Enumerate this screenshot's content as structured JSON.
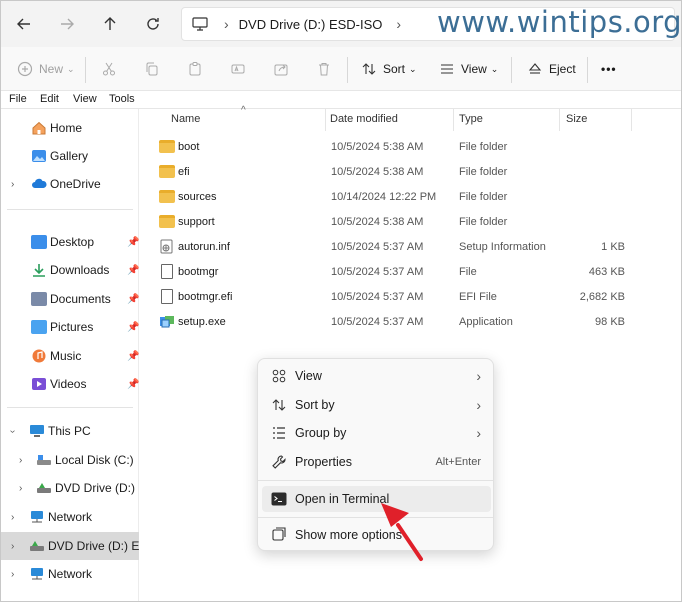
{
  "address": {
    "segments": [
      "DVD Drive (D:) ESD-ISO"
    ]
  },
  "watermark": "www.wintips.org",
  "toolbar": {
    "new_label": "New",
    "sort_label": "Sort",
    "view_label": "View",
    "eject_label": "Eject",
    "more_label": "•••"
  },
  "menubar": [
    "File",
    "Edit",
    "View",
    "Tools"
  ],
  "sidebar": {
    "items": [
      {
        "label": "Home"
      },
      {
        "label": "Gallery"
      },
      {
        "label": "OneDrive"
      },
      {
        "label": "Desktop"
      },
      {
        "label": "Downloads"
      },
      {
        "label": "Documents"
      },
      {
        "label": "Pictures"
      },
      {
        "label": "Music"
      },
      {
        "label": "Videos"
      },
      {
        "label": "This PC"
      },
      {
        "label": "Local Disk (C:)"
      },
      {
        "label": "DVD Drive (D:) ESD"
      },
      {
        "label": "Network"
      },
      {
        "label": "DVD Drive (D:) ESD-"
      },
      {
        "label": "Network"
      }
    ]
  },
  "columns": {
    "name": "Name",
    "date": "Date modified",
    "type": "Type",
    "size": "Size"
  },
  "files": [
    {
      "name": "boot",
      "date": "10/5/2024 5:38 AM",
      "type": "File folder",
      "size": ""
    },
    {
      "name": "efi",
      "date": "10/5/2024 5:38 AM",
      "type": "File folder",
      "size": ""
    },
    {
      "name": "sources",
      "date": "10/14/2024 12:22 PM",
      "type": "File folder",
      "size": ""
    },
    {
      "name": "support",
      "date": "10/5/2024 5:38 AM",
      "type": "File folder",
      "size": ""
    },
    {
      "name": "autorun.inf",
      "date": "10/5/2024 5:37 AM",
      "type": "Setup Information",
      "size": "1 KB"
    },
    {
      "name": "bootmgr",
      "date": "10/5/2024 5:37 AM",
      "type": "File",
      "size": "463 KB"
    },
    {
      "name": "bootmgr.efi",
      "date": "10/5/2024 5:37 AM",
      "type": "EFI File",
      "size": "2,682 KB"
    },
    {
      "name": "setup.exe",
      "date": "10/5/2024 5:37 AM",
      "type": "Application",
      "size": "98 KB"
    }
  ],
  "context_menu": {
    "view": "View",
    "sort_by": "Sort by",
    "group_by": "Group by",
    "properties": "Properties",
    "properties_shortcut": "Alt+Enter",
    "open_terminal": "Open in Terminal",
    "show_more": "Show more options"
  },
  "colors": {
    "arrow": "#e0202a",
    "folder": "#f2c14e",
    "selected": "#d9d9d9"
  }
}
